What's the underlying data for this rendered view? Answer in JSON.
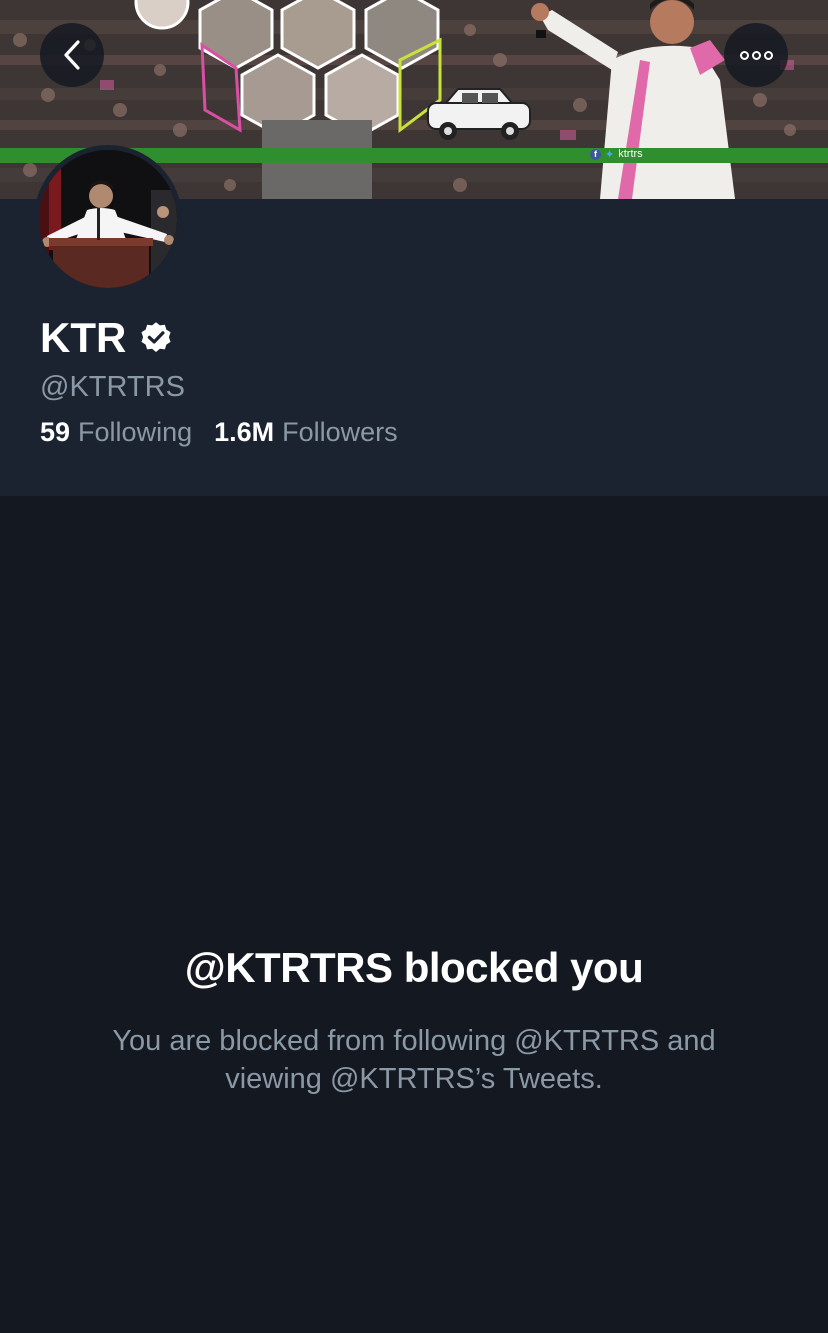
{
  "banner": {
    "social_handle": "ktrtrs",
    "stripe_color": "#2f8f2e"
  },
  "nav": {
    "back_icon": "chevron-left-icon",
    "more_icon": "more-dots-icon"
  },
  "profile": {
    "name": "KTR",
    "handle": "@KTRTRS",
    "verified": true,
    "following_count": "59",
    "following_label": "Following",
    "followers_count": "1.6M",
    "followers_label": "Followers"
  },
  "blocked": {
    "title": "@KTRTRS blocked you",
    "line1": "You are blocked from following @KTRTRS and",
    "line2": "viewing @KTRTRS’s Tweets."
  },
  "colors": {
    "background": "#141821",
    "header_background": "#1b2330",
    "secondary_text": "#8b98a5",
    "verified_badge": "#ffffff"
  }
}
